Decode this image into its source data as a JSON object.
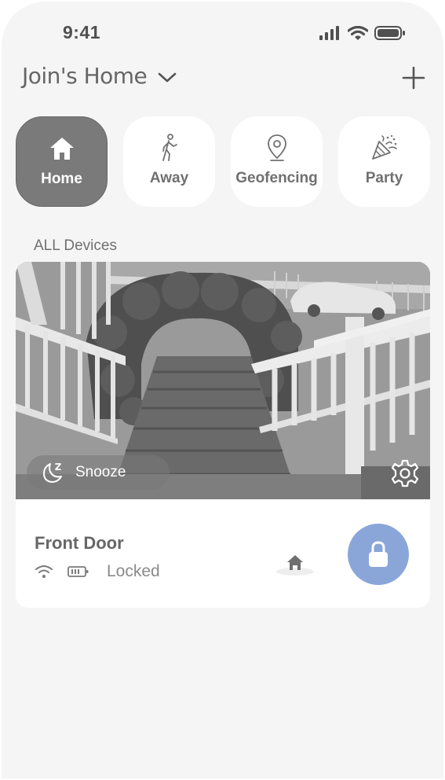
{
  "status_bar": {
    "time": "9:41"
  },
  "header": {
    "home_name": "Join's Home"
  },
  "modes": [
    {
      "label": "Home",
      "icon": "home-icon",
      "active": true
    },
    {
      "label": "Away",
      "icon": "walking-person-icon",
      "active": false
    },
    {
      "label": "Geofencing",
      "icon": "location-pin-icon",
      "active": false
    },
    {
      "label": "Party",
      "icon": "party-popper-icon",
      "active": false
    }
  ],
  "section_title": "ALL Devices",
  "device": {
    "snooze_label": "Snooze",
    "name": "Front Door",
    "status": "Locked"
  },
  "colors": {
    "background": "#f5f5f5",
    "active_mode": "#7a7a7a",
    "lock_button": "#8aa6d9"
  }
}
